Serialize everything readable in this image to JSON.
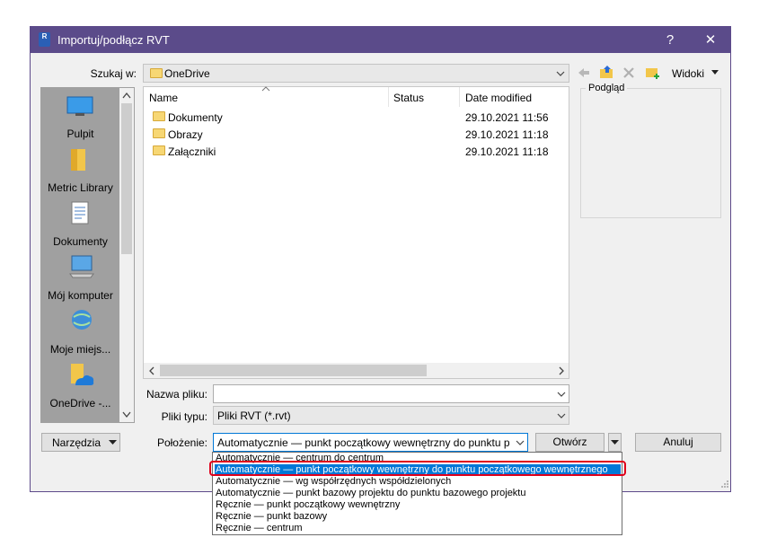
{
  "dialog": {
    "title": "Importuj/podłącz RVT",
    "help": "?",
    "close": "✕"
  },
  "lookin": {
    "label": "Szukaj w:",
    "value": "OneDrive",
    "toolbar_views": "Widoki"
  },
  "places": [
    {
      "label": "Pulpit",
      "icon": "desktop-icon"
    },
    {
      "label": "Metric Library",
      "icon": "library-folder-icon"
    },
    {
      "label": "Dokumenty",
      "icon": "documents-icon"
    },
    {
      "label": "Mój komputer",
      "icon": "computer-icon"
    },
    {
      "label": "Moje miejs...",
      "icon": "network-places-icon"
    },
    {
      "label": "OneDrive -...",
      "icon": "onedrive-icon"
    }
  ],
  "filelist": {
    "columns": [
      "Name",
      "Status",
      "Date modified"
    ],
    "rows": [
      {
        "name": "Dokumenty",
        "status": "",
        "date": "29.10.2021 11:56"
      },
      {
        "name": "Obrazy",
        "status": "",
        "date": "29.10.2021 11:18"
      },
      {
        "name": "Załączniki",
        "status": "",
        "date": "29.10.2021 11:18"
      }
    ]
  },
  "preview": {
    "label": "Podgląd"
  },
  "filename": {
    "label": "Nazwa pliku:",
    "value": ""
  },
  "filetype": {
    "label": "Pliki typu:",
    "value": "Pliki RVT  (*.rvt)"
  },
  "position": {
    "label": "Położenie:",
    "value": "Automatycznie — punkt początkowy wewnętrzny do punktu początk",
    "options": [
      "Automatycznie — centrum do centrum",
      "Automatycznie — punkt początkowy wewnętrzny do punktu początkowego wewnętrznego",
      "Automatycznie — wg współrzędnych współdzielonych",
      "Automatycznie — punkt bazowy projektu do punktu bazowego projektu",
      "Ręcznie — punkt początkowy wewnętrzny",
      "Ręcznie — punkt bazowy",
      "Ręcznie — centrum"
    ],
    "selected_index": 1
  },
  "buttons": {
    "tools": "Narzędzia",
    "open": "Otwórz",
    "cancel": "Anuluj"
  },
  "colors": {
    "titlebar": "#5b4b8a",
    "selection": "#0078d7",
    "highlight": "#e0001b"
  }
}
